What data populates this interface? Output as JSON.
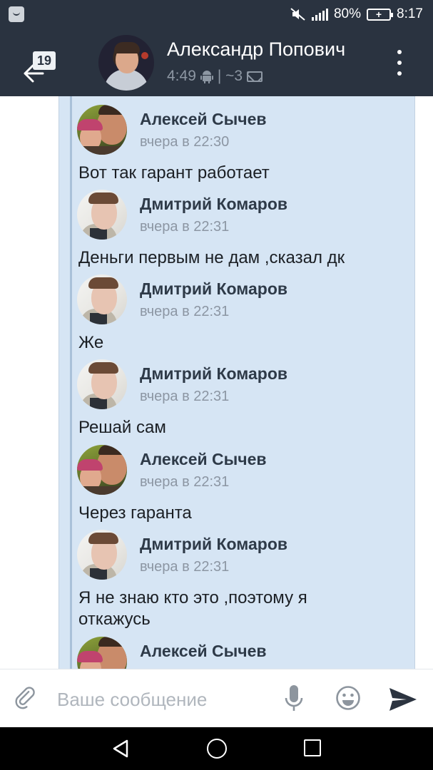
{
  "status_bar": {
    "battery": "80%",
    "time": "8:17"
  },
  "header": {
    "unread_count": "19",
    "title": "Александр Попович",
    "last_seen": "4:49",
    "separator": "| ~3",
    "icons": [
      "back-arrow-icon",
      "android-icon",
      "envelope-icon",
      "more-vertical-icon"
    ]
  },
  "messages": [
    {
      "author": "Алексей Сычев",
      "time": "вчера в 22:30",
      "text": "Вот так гарант работает",
      "avatar": "alexey"
    },
    {
      "author": "Дмитрий Комаров",
      "time": "вчера в 22:31",
      "text": "Деньги первым не дам ,сказал дк",
      "avatar": "dmitry"
    },
    {
      "author": "Дмитрий Комаров",
      "time": "вчера в 22:31",
      "text": "Же",
      "avatar": "dmitry"
    },
    {
      "author": "Дмитрий Комаров",
      "time": "вчера в 22:31",
      "text": "Решай сам",
      "avatar": "dmitry"
    },
    {
      "author": "Алексей Сычев",
      "time": "вчера в 22:31",
      "text": "Через гаранта",
      "avatar": "alexey"
    },
    {
      "author": "Дмитрий Комаров",
      "time": "вчера в 22:31",
      "text": "Я не знаю кто это ,поэтому я откажусь",
      "avatar": "dmitry"
    },
    {
      "author": "Алексей Сычев",
      "time": "",
      "text": "",
      "avatar": "alexey"
    }
  ],
  "composer": {
    "placeholder": "Ваше сообщение",
    "value": "",
    "icons": [
      "paperclip-icon",
      "microphone-icon",
      "emoji-icon",
      "send-icon"
    ]
  },
  "nav": {
    "icons": [
      "nav-back-icon",
      "nav-home-icon",
      "nav-recents-icon"
    ]
  },
  "colors": {
    "header_bg": "#2a3340",
    "forward_bg": "#d6e5f4",
    "name_color": "#2e3a48",
    "time_color": "#8c96a3"
  }
}
